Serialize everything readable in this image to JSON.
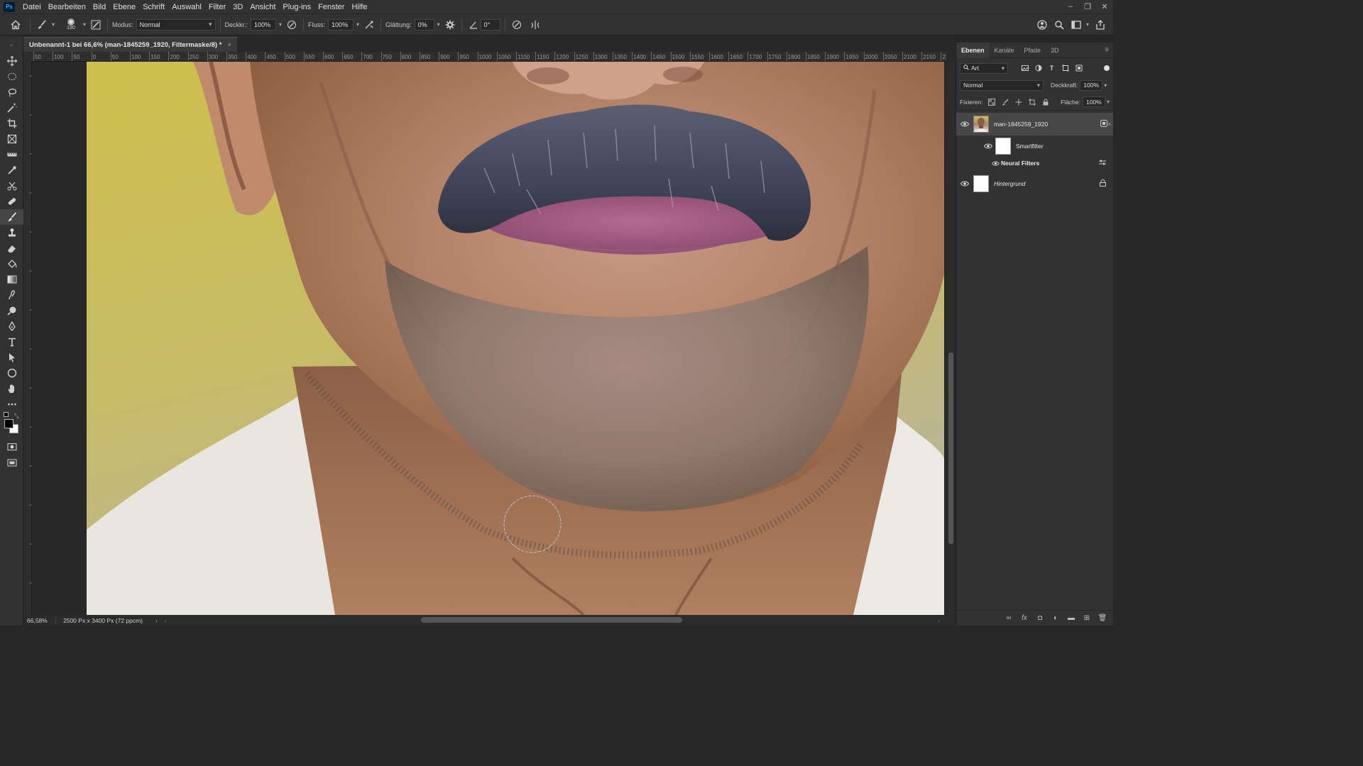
{
  "app": {
    "logo": "Ps"
  },
  "menu": [
    "Datei",
    "Bearbeiten",
    "Bild",
    "Ebene",
    "Schrift",
    "Auswahl",
    "Filter",
    "3D",
    "Ansicht",
    "Plug-ins",
    "Fenster",
    "Hilfe"
  ],
  "window_controls": {
    "minimize": "–",
    "restore": "❐",
    "close": "✕"
  },
  "options": {
    "brush_size": "190",
    "mode_label": "Modus:",
    "mode_value": "Normal",
    "opacity_label": "Deckkr.:",
    "opacity_value": "100%",
    "flow_label": "Fluss:",
    "flow_value": "100%",
    "smoothing_label": "Glättung:",
    "smoothing_value": "0%",
    "angle_value": "0°"
  },
  "document": {
    "tab_title": "Unbenannt-1 bei 66,6% (man-1845259_1920, Filtermaske/8) *",
    "close": "×",
    "zoom": "66,58%",
    "dimensions": "2500 Px x 3400 Px (72 ppcm)",
    "ruler_labels": [
      "50",
      "100",
      "50",
      "0",
      "50",
      "100",
      "150",
      "200",
      "250",
      "300",
      "350",
      "400",
      "450",
      "500",
      "550",
      "600",
      "650",
      "700",
      "750",
      "800",
      "850",
      "900",
      "950",
      "1000",
      "1050",
      "1100",
      "1150",
      "1200",
      "1250",
      "1300",
      "1350",
      "1400",
      "1450",
      "1500",
      "1550",
      "1600",
      "1650",
      "1700",
      "1750",
      "1800",
      "1850",
      "1900",
      "1950",
      "2000",
      "2050",
      "2100",
      "2150",
      "220"
    ]
  },
  "panel": {
    "tabs": [
      "Ebenen",
      "Kanäle",
      "Pfade",
      "3D"
    ],
    "active_tab": "Ebenen",
    "filter_kind": "Art",
    "blend_mode": "Normal",
    "opacity_label": "Deckkraft:",
    "opacity_value": "100%",
    "lock_label": "Fixieren:",
    "fill_label": "Fläche:",
    "fill_value": "100%",
    "layers": {
      "main": {
        "name": "man-1845259_1920"
      },
      "smartfilter": {
        "name": "Smartfilter"
      },
      "neural": {
        "name": "Neural Filters"
      },
      "background": {
        "name": "Hintergrund"
      }
    }
  },
  "colors": {
    "chrome": "#323232",
    "canvas_bg": "#282828",
    "selected_layer": "#474747",
    "wall_yellow": "#c9b84a"
  },
  "icons": {
    "tools": [
      "move-icon",
      "marquee-icon",
      "lasso-icon",
      "magic-wand-icon",
      "crop-icon",
      "frame-icon",
      "ruler-icon",
      "eyedropper-icon",
      "scissors-icon",
      "healing-brush-icon",
      "brush-icon",
      "clone-stamp-icon",
      "eraser-icon",
      "paint-bucket-icon",
      "gradient-icon",
      "smudge-icon",
      "dodge-icon",
      "pen-icon",
      "type-icon",
      "path-selection-icon",
      "ellipse-icon",
      "hand-icon",
      "more-tools-icon"
    ]
  }
}
